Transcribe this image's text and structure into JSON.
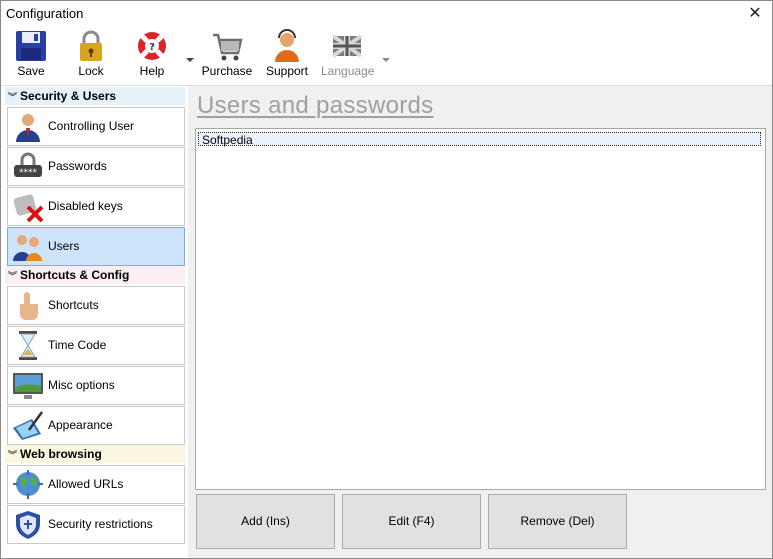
{
  "window": {
    "title": "Configuration",
    "close_glyph": "✕"
  },
  "toolbar": {
    "buttons": [
      {
        "label": "Save",
        "icon": "floppy-disk-icon"
      },
      {
        "label": "Lock",
        "icon": "padlock-icon"
      },
      {
        "label": "Help",
        "icon": "lifebuoy-icon"
      },
      {
        "label": "Purchase",
        "icon": "shopping-cart-icon"
      },
      {
        "label": "Support",
        "icon": "support-person-icon"
      },
      {
        "label": "Language",
        "icon": "uk-flag-icon",
        "disabled": true
      }
    ]
  },
  "sidebar": {
    "groups": [
      {
        "label": "Security & Users",
        "items": [
          {
            "label": "Controlling User",
            "icon": "user-icon"
          },
          {
            "label": "Passwords",
            "icon": "password-padlock-icon"
          },
          {
            "label": "Disabled keys",
            "icon": "disabled-keys-icon"
          },
          {
            "label": "Users",
            "icon": "users-icon",
            "selected": true
          }
        ]
      },
      {
        "label": "Shortcuts & Config",
        "items": [
          {
            "label": "Shortcuts",
            "icon": "hand-pointer-icon"
          },
          {
            "label": "Time Code",
            "icon": "hourglass-icon"
          },
          {
            "label": "Misc options",
            "icon": "monitor-icon"
          },
          {
            "label": "Appearance",
            "icon": "pen-tablet-icon"
          }
        ]
      },
      {
        "label": "Web browsing",
        "items": [
          {
            "label": "Allowed URLs",
            "icon": "globe-icon"
          },
          {
            "label": "Security restrictions",
            "icon": "shield-icon"
          }
        ]
      }
    ]
  },
  "main": {
    "heading": "Users and passwords",
    "users": [
      "Softpedia"
    ],
    "buttons": {
      "add": "Add (Ins)",
      "edit": "Edit (F4)",
      "remove": "Remove (Del)"
    }
  },
  "colors": {
    "selected_bg": "#cde4fa",
    "heading_gray": "#a0a0a0",
    "group1_bg": "#e6f2fa",
    "group2_bg": "#fdeef4",
    "group3_bg": "#fbf6df"
  }
}
